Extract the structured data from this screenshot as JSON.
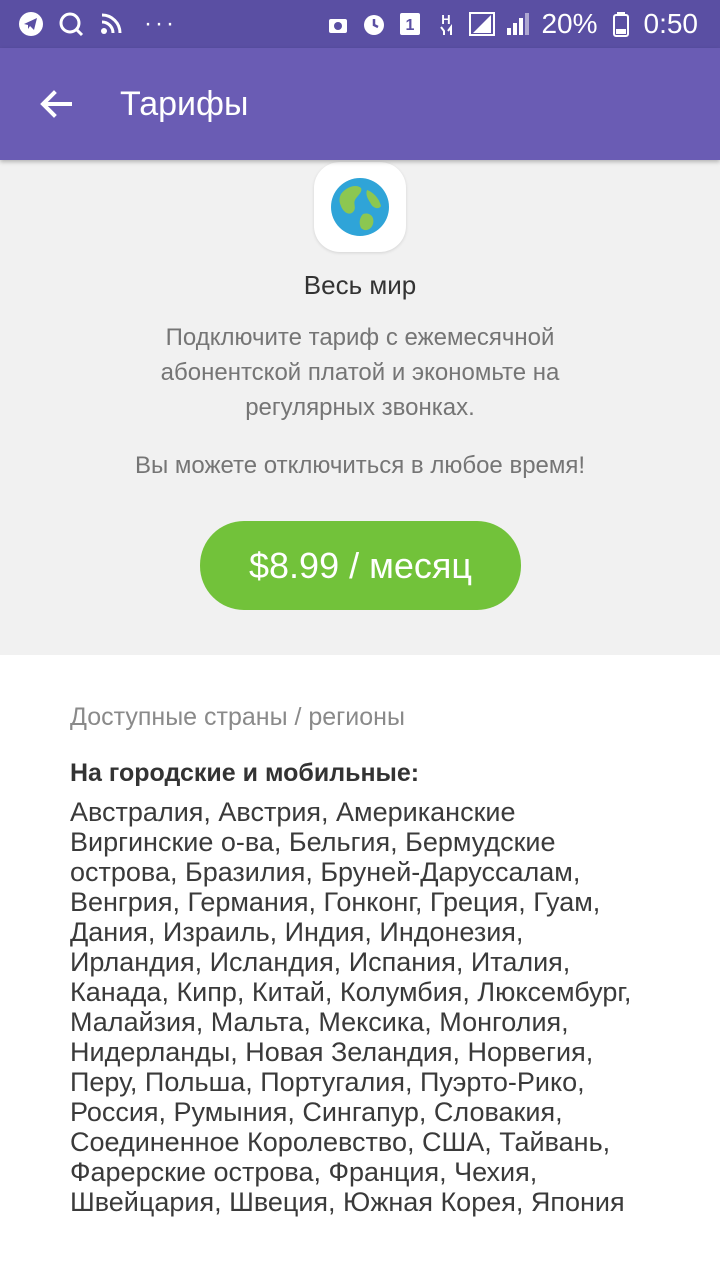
{
  "status_bar": {
    "battery_percent": "20%",
    "time": "0:50",
    "sim_badge": "1",
    "network_type": "H",
    "left_icons": [
      "telegram-icon",
      "search-chat-icon",
      "rss-icon"
    ],
    "right_icons": [
      "android-icon",
      "alarm-icon",
      "sim-icon",
      "network-icon",
      "signal-icon",
      "signal-icon",
      "battery-icon"
    ]
  },
  "app_bar": {
    "title": "Тарифы",
    "back_icon": "arrow-back-icon"
  },
  "plan": {
    "icon": "globe-icon",
    "title": "Весь мир",
    "description": "Подключите тариф с ежемесячной абонентской платой и экономьте на регулярных звонках.",
    "note": "Вы можете отключиться в любое время!",
    "price_label": "$8.99 / месяц"
  },
  "countries": {
    "section_label": "Доступные страны / регионы",
    "sub_heading": "На городские и мобильные:",
    "list": "Австралия, Австрия, Американские Виргинские о‑ва, Бельгия, Бермудские острова, Бразилия, Бруней‑Даруссалам, Венгрия, Германия, Гонконг, Греция, Гуам, Дания, Израиль, Индия, Индонезия, Ирландия, Исландия, Испания, Италия, Канада, Кипр, Китай, Колумбия, Люксембург, Малайзия, Мальта, Мексика, Монголия, Нидерланды, Новая Зеландия, Норвегия, Перу, Польша, Португалия, Пуэрто‑Рико, Россия, Румыния, Сингапур, Словакия, Соединенное Королевство, США, Тайвань, Фарерские острова, Франция, Чехия, Швейцария, Швеция, Южная Корея, Япония"
  },
  "colors": {
    "status_bar": "#5a4fa3",
    "app_bar": "#6a5cb4",
    "price_button": "#72c23a",
    "hero_background": "#f1f1f1"
  }
}
